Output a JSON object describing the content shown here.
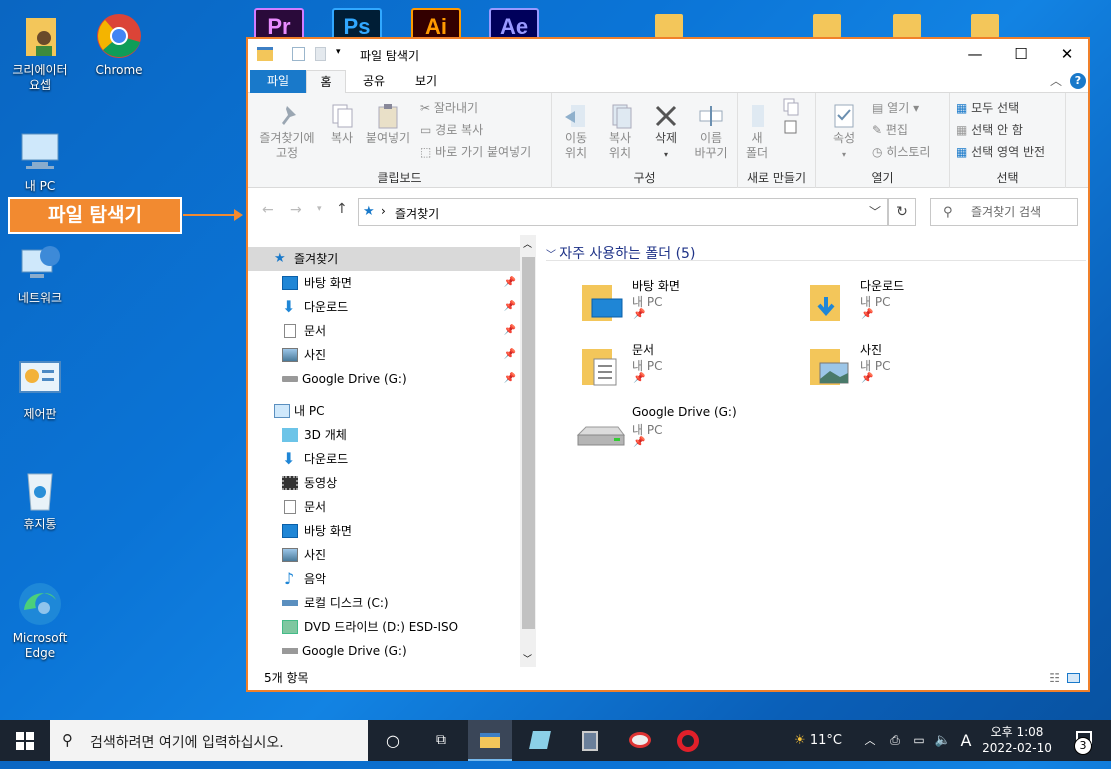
{
  "desktop": {
    "icons": [
      {
        "label": "크리에이터\n요셉"
      },
      {
        "label": "Chrome"
      },
      {
        "label": "내 PC"
      },
      {
        "label": "네트워크"
      },
      {
        "label": "제어판"
      },
      {
        "label": "휴지통"
      },
      {
        "label": "Microsoft\nEdge"
      }
    ],
    "top_apps": [
      "Pr",
      "Ps",
      "Ai",
      "Ae"
    ],
    "callout": "파일 탐색기"
  },
  "window": {
    "title": "파일 탐색기",
    "tabs": [
      "파일",
      "홈",
      "공유",
      "보기"
    ],
    "ribbon": {
      "clipboard": {
        "pin": "즐겨찾기에\n고정",
        "copy": "복사",
        "paste": "붙여넣기",
        "cut": "잘라내기",
        "copy_path": "경로 복사",
        "paste_shortcut": "바로 가기 붙여넣기",
        "label": "클립보드"
      },
      "organize": {
        "move": "이동\n위치",
        "copy_to": "복사\n위치",
        "delete": "삭제",
        "rename": "이름\n바꾸기",
        "label": "구성"
      },
      "new": {
        "new_folder": "새\n폴더",
        "label": "새로 만들기"
      },
      "open": {
        "properties": "속성",
        "open": "열기",
        "edit": "편집",
        "history": "히스토리",
        "label": "열기"
      },
      "select": {
        "select_all": "모두 선택",
        "select_none": "선택 안 함",
        "invert": "선택 영역 반전",
        "label": "선택"
      }
    },
    "address": {
      "path": "즐겨찾기",
      "search_placeholder": "즐겨찾기 검색"
    },
    "nav": {
      "quick_access": "즐겨찾기",
      "quick_items": [
        "바탕 화면",
        "다운로드",
        "문서",
        "사진",
        "Google Drive (G:)"
      ],
      "this_pc": "내 PC",
      "pc_items": [
        "3D 개체",
        "다운로드",
        "동영상",
        "문서",
        "바탕 화면",
        "사진",
        "음악",
        "로컬 디스크 (C:)",
        "DVD 드라이브 (D:) ESD-ISO",
        "Google Drive (G:)"
      ]
    },
    "content": {
      "group_title": "자주 사용하는 폴더 (5)",
      "tiles": [
        {
          "name": "바탕 화면",
          "sub": "내 PC"
        },
        {
          "name": "다운로드",
          "sub": "내 PC"
        },
        {
          "name": "문서",
          "sub": "내 PC"
        },
        {
          "name": "사진",
          "sub": "내 PC"
        },
        {
          "name": "Google Drive (G:)",
          "sub": "내 PC"
        }
      ]
    },
    "status": "5개 항목"
  },
  "taskbar": {
    "search_placeholder": "검색하려면 여기에 입력하십시오.",
    "weather": "11°C",
    "ime": "A",
    "time": "오후 1:08",
    "date": "2022-02-10",
    "notif_count": "3"
  },
  "colors": {
    "accent": "#1979ca",
    "callout": "#f28a30",
    "folder": "#f3c65a"
  }
}
